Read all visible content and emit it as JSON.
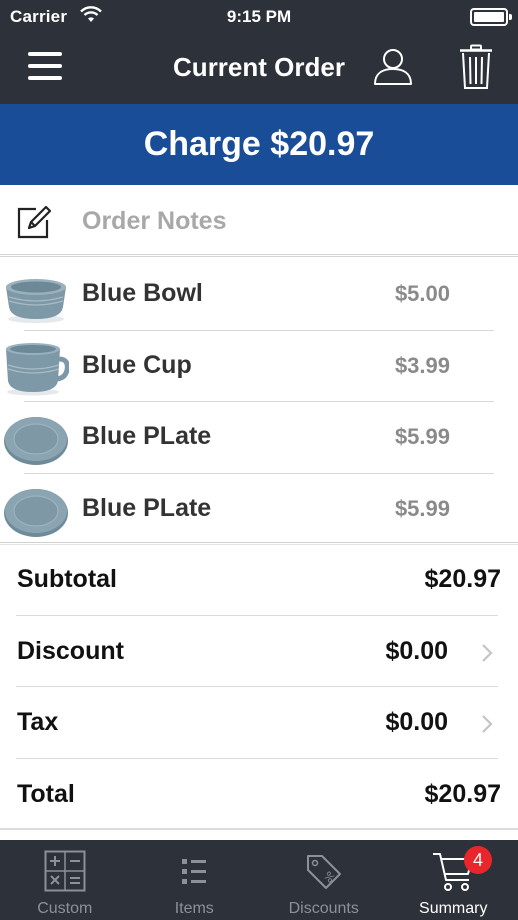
{
  "status_bar": {
    "carrier": "Carrier",
    "time": "9:15 PM",
    "battery_level": 1.0
  },
  "nav": {
    "title": "Current Order",
    "menu_icon": "hamburger-menu-icon",
    "user_icon": "user-icon",
    "trash_icon": "trash-icon"
  },
  "charge_label": "Charge $20.97",
  "notes": {
    "placeholder": "Order Notes",
    "icon": "pencil-edit-icon"
  },
  "items": [
    {
      "name": "Blue Bowl",
      "price": "$5.00",
      "thumb": "bowl"
    },
    {
      "name": "Blue Cup",
      "price": "$3.99",
      "thumb": "cup"
    },
    {
      "name": "Blue PLate",
      "price": "$5.99",
      "thumb": "plate"
    },
    {
      "name": "Blue PLate",
      "price": "$5.99",
      "thumb": "plate"
    }
  ],
  "totals": {
    "subtotal": {
      "label": "Subtotal",
      "value": "$20.97"
    },
    "discount": {
      "label": "Discount",
      "value": "$0.00"
    },
    "tax": {
      "label": "Tax",
      "value": "$0.00"
    },
    "total": {
      "label": "Total",
      "value": "$20.97"
    }
  },
  "tabs": [
    {
      "label": "Custom",
      "icon": "calculator-icon"
    },
    {
      "label": "Items",
      "icon": "list-icon"
    },
    {
      "label": "Discounts",
      "icon": "tag-icon"
    },
    {
      "label": "Summary",
      "icon": "cart-icon",
      "badge": "4"
    }
  ],
  "colors": {
    "nav_bg": "#2d3139",
    "charge_bg": "#1a4d98",
    "badge": "#e9262c",
    "product_blue": "#7d98a6"
  }
}
